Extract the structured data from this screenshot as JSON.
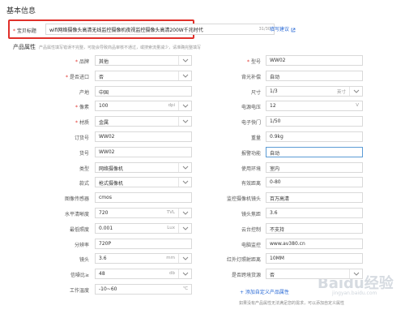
{
  "section_title": "基本信息",
  "title_field": {
    "label": "宝贝标题",
    "value": "wifi网络摄像头高清无线监控摄像机夜视监控摄像头高清200W千兆时代",
    "counter": "31/30"
  },
  "fill_tip": "填写建议",
  "props_head": "产品属性",
  "props_hint": "产品属性填写错误不完整，可能会导致商品审核不通过，或搜索流量减少，请准确完整填写",
  "left_fields": [
    {
      "label": "品牌",
      "required": true,
      "value": "其他",
      "unit": "",
      "dropdown": true
    },
    {
      "label": "是否进口",
      "required": true,
      "value": "否",
      "unit": "",
      "dropdown": true
    },
    {
      "label": "产地",
      "required": false,
      "value": "中国",
      "unit": "",
      "dropdown": false
    },
    {
      "label": "像素",
      "required": true,
      "value": "100",
      "unit": "dpi",
      "dropdown": true
    },
    {
      "label": "材质",
      "required": true,
      "value": "金属",
      "unit": "",
      "dropdown": true
    },
    {
      "label": "订货号",
      "required": false,
      "value": "WW02",
      "unit": "",
      "dropdown": false
    },
    {
      "label": "货号",
      "required": false,
      "value": "WW02",
      "unit": "",
      "dropdown": false
    },
    {
      "label": "类型",
      "required": false,
      "value": "网络摄像机",
      "unit": "",
      "dropdown": true
    },
    {
      "label": "款式",
      "required": false,
      "value": "枪式摄像机",
      "unit": "",
      "dropdown": true
    },
    {
      "label": "图像传感器",
      "required": false,
      "value": "cmos",
      "unit": "",
      "dropdown": false
    },
    {
      "label": "水平清晰度",
      "required": false,
      "value": "720",
      "unit": "TVL",
      "dropdown": true
    },
    {
      "label": "最低照度",
      "required": false,
      "value": "0.001",
      "unit": "Lux",
      "dropdown": true
    },
    {
      "label": "分辨率",
      "required": false,
      "value": "720P",
      "unit": "",
      "dropdown": false
    },
    {
      "label": "镜头",
      "required": false,
      "value": "3.6",
      "unit": "mm",
      "dropdown": true
    },
    {
      "label": "信噪比≥",
      "required": false,
      "value": "48",
      "unit": "db",
      "dropdown": true
    },
    {
      "label": "工作温度",
      "required": false,
      "value": "-10~60",
      "unit": "℃",
      "dropdown": false
    }
  ],
  "right_fields": [
    {
      "label": "型号",
      "required": true,
      "value": "WW02",
      "unit": "",
      "dropdown": false
    },
    {
      "label": "背光补偿",
      "required": false,
      "value": "自动",
      "unit": "",
      "dropdown": false
    },
    {
      "label": "尺寸",
      "required": false,
      "value": "1/3",
      "unit": "英寸",
      "dropdown": true
    },
    {
      "label": "电源电压",
      "required": false,
      "value": "12",
      "unit": "V",
      "dropdown": false
    },
    {
      "label": "电子快门",
      "required": false,
      "value": "1/50",
      "unit": "",
      "dropdown": false
    },
    {
      "label": "重量",
      "required": false,
      "value": "0.9kg",
      "unit": "",
      "dropdown": false
    },
    {
      "label": "报警功能",
      "required": false,
      "value": "自动",
      "unit": "",
      "dropdown": false
    },
    {
      "label": "使用环境",
      "required": false,
      "value": "室内",
      "unit": "",
      "dropdown": false
    },
    {
      "label": "有效距离",
      "required": false,
      "value": "0-80",
      "unit": "",
      "dropdown": false
    },
    {
      "label": "监控摄像机镜头",
      "required": false,
      "value": "百万高清",
      "unit": "",
      "dropdown": false
    },
    {
      "label": "镜头焦距",
      "required": false,
      "value": "3.6",
      "unit": "",
      "dropdown": false
    },
    {
      "label": "云台控制",
      "required": false,
      "value": "不支持",
      "unit": "",
      "dropdown": false
    },
    {
      "label": "电脑监控",
      "required": false,
      "value": "www.av380.cn",
      "unit": "",
      "dropdown": false
    },
    {
      "label": "红外灯照射距离",
      "required": false,
      "value": "10MM",
      "unit": "",
      "dropdown": false
    },
    {
      "label": "是否跨境货源",
      "required": false,
      "value": "否",
      "unit": "",
      "dropdown": true
    }
  ],
  "add_link": "+ 添加自定义产品属性",
  "bottom_note": "如果没有产品属性无法满足您的需求，可以添加自定义属性",
  "watermark": "Baidu经验",
  "watermark_sub": "jingyan.baidu.com",
  "colors": {
    "required": "#e0302a",
    "link": "#2b6bd6",
    "highlight_border": "#e0302a"
  }
}
